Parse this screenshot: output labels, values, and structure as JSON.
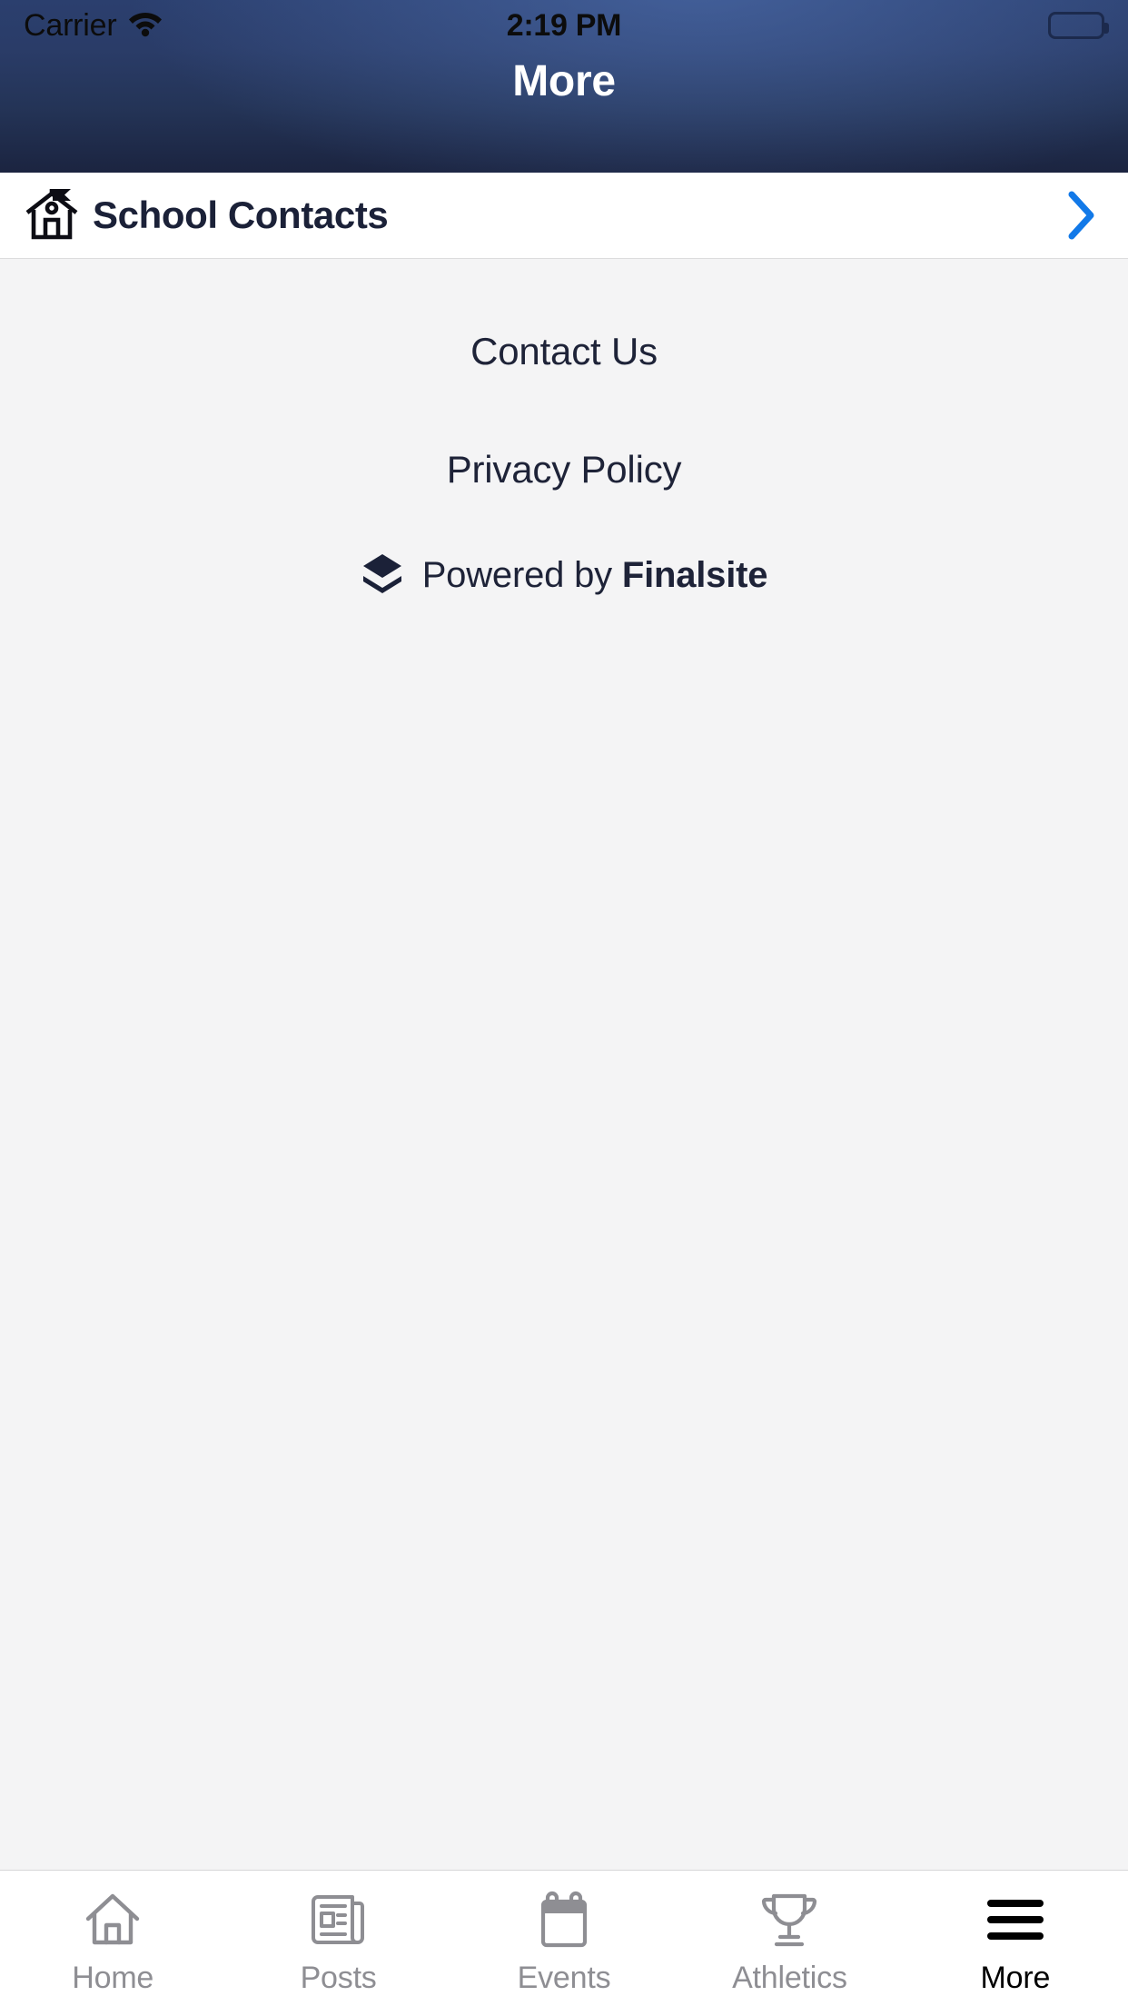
{
  "status_bar": {
    "carrier": "Carrier",
    "wifi_icon": "wifi-icon",
    "time": "2:19 PM",
    "battery_icon": "battery-full-icon"
  },
  "navbar": {
    "title": "More",
    "background_top": "#2b3f6e",
    "background_bottom": "#1b2440",
    "title_color": "#ffffff"
  },
  "list": {
    "rows": [
      {
        "label": "School Contacts",
        "icon": "school-house-icon",
        "accessory": "chevron-right-icon"
      }
    ]
  },
  "content": {
    "background": "#f4f4f5",
    "links": [
      {
        "label": "Contact Us"
      },
      {
        "label": "Privacy Policy"
      }
    ],
    "powered_by": {
      "prefix": "Powered by ",
      "brand": "Finalsite",
      "icon": "finalsite-layers-icon"
    }
  },
  "tabbar": {
    "active_index": 4,
    "inactive_color": "#8e8e93",
    "active_color": "#000000",
    "tabs": [
      {
        "label": "Home",
        "icon": "home-icon"
      },
      {
        "label": "Posts",
        "icon": "newspaper-icon"
      },
      {
        "label": "Events",
        "icon": "calendar-icon"
      },
      {
        "label": "Athletics",
        "icon": "trophy-icon"
      },
      {
        "label": "More",
        "icon": "hamburger-menu-icon"
      }
    ]
  },
  "colors": {
    "accent_blue": "#1279e8",
    "text_dark": "#1b2138",
    "content_bg": "#f4f4f5",
    "row_bg": "#ffffff"
  }
}
